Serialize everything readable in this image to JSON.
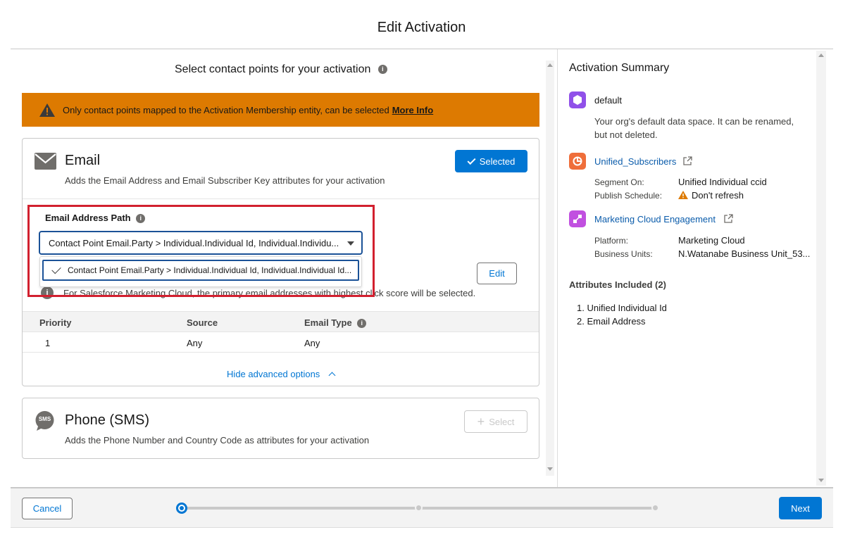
{
  "modal": {
    "title": "Edit Activation"
  },
  "left": {
    "subheading": "Select contact points for your activation",
    "warning": {
      "text": "Only contact points mapped to the Activation Membership entity, can be selected",
      "link": "More Info"
    },
    "email_card": {
      "title": "Email",
      "description": "Adds the Email Address and Email Subscriber Key attributes for your activation",
      "selected_label": "Selected",
      "path_label": "Email Address Path",
      "path_value": "Contact Point Email.Party > Individual.Individual Id, Individual.Individu...",
      "dropdown_option": "Contact Point Email.Party > Individual.Individual Id, Individual.Individual Id...",
      "edit_label": "Edit",
      "note": "For Salesforce Marketing Cloud, the primary email addresses with highest click score will be selected.",
      "table": {
        "headers": [
          "Priority",
          "Source",
          "Email Type"
        ],
        "rows": [
          [
            "1",
            "Any",
            "Any"
          ]
        ]
      },
      "advanced_toggle": "Hide advanced options"
    },
    "phone_card": {
      "title": "Phone (SMS)",
      "description": "Adds the Phone Number and Country Code as attributes for your activation",
      "select_label": "Select",
      "icon_text": "SMS"
    }
  },
  "summary": {
    "title": "Activation Summary",
    "data_space": {
      "name": "default",
      "description": "Your org's default data space. It can be renamed, but not deleted."
    },
    "segment": {
      "name": "Unified_Subscribers",
      "segment_on_label": "Segment On:",
      "segment_on_value": "Unified Individual ccid",
      "schedule_label": "Publish Schedule:",
      "schedule_value": "Don't refresh"
    },
    "target": {
      "name": "Marketing Cloud Engagement",
      "platform_label": "Platform:",
      "platform_value": "Marketing Cloud",
      "bu_label": "Business Units:",
      "bu_value": "N.Watanabe Business Unit_53..."
    },
    "attributes_heading": "Attributes Included (2)",
    "attributes": [
      "1. Unified Individual Id",
      "2. Email Address"
    ]
  },
  "footer": {
    "cancel_label": "Cancel",
    "next_label": "Next",
    "progress": {
      "steps": 3,
      "current_step": 1
    }
  },
  "colors": {
    "brand": "#0176d3",
    "warning": "#dd7a01",
    "highlight": "#d2202f"
  }
}
